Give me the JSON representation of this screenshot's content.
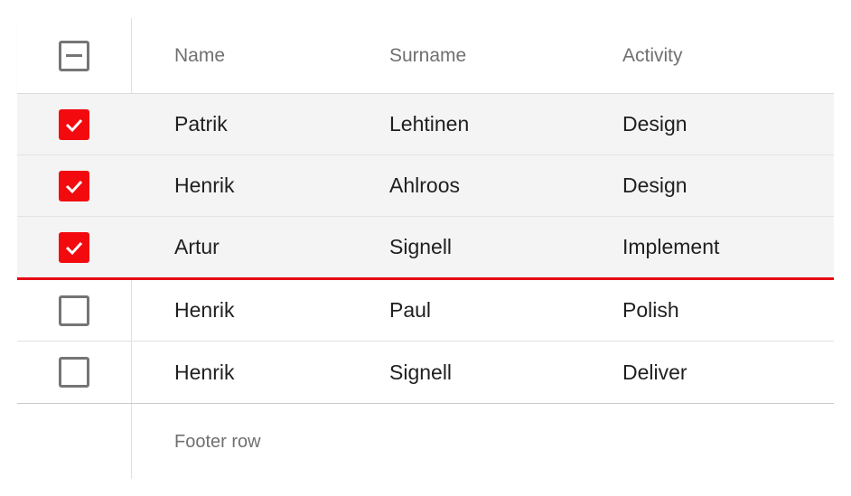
{
  "header": {
    "select_all_state": "indeterminate",
    "columns": [
      "Name",
      "Surname",
      "Activity"
    ]
  },
  "rows": [
    {
      "selected": true,
      "name": "Patrik",
      "surname": "Lehtinen",
      "activity": "Design"
    },
    {
      "selected": true,
      "name": "Henrik",
      "surname": "Ahlroos",
      "activity": "Design"
    },
    {
      "selected": true,
      "name": "Artur",
      "surname": "Signell",
      "activity": "Implement"
    },
    {
      "selected": false,
      "name": "Henrik",
      "surname": "Paul",
      "activity": "Polish"
    },
    {
      "selected": false,
      "name": "Henrik",
      "surname": "Signell",
      "activity": "Deliver"
    }
  ],
  "footer": {
    "label": "Footer row"
  },
  "colors": {
    "accent": "#f20a0f",
    "selected_row_bg": "#f4f4f4",
    "checkbox_border": "#757575"
  },
  "icons": {
    "checked": "checkmark-icon",
    "indeterminate": "minus-icon"
  }
}
